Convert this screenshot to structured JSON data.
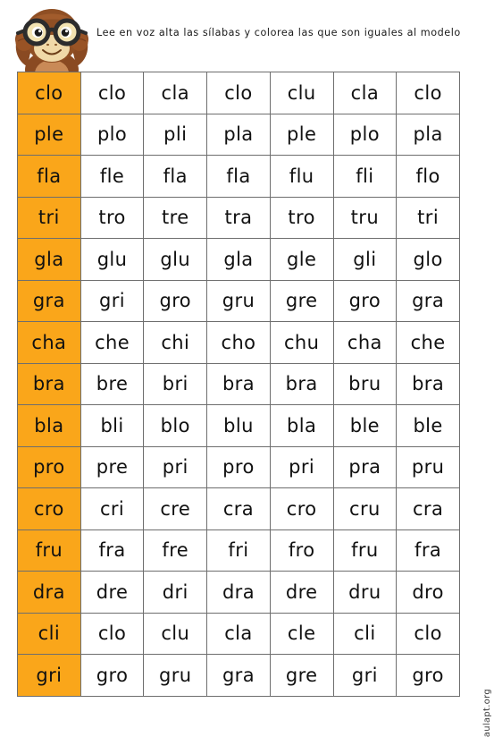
{
  "header": {
    "instruction": "Lee en voz alta las sílabas y colorea las que son iguales al modelo",
    "mascot_name": "monkey-with-glasses"
  },
  "colors": {
    "model_cell": "#faa61a",
    "grid_border": "#6e6e6e",
    "text": "#111111",
    "page_background": "#ffffff"
  },
  "table": {
    "columns": 7,
    "rows_count": 15,
    "model_column_index": 0,
    "rows": [
      {
        "model": "clo",
        "options": [
          "clo",
          "cla",
          "clo",
          "clu",
          "cla",
          "clo"
        ]
      },
      {
        "model": "ple",
        "options": [
          "plo",
          "pli",
          "pla",
          "ple",
          "plo",
          "pla"
        ]
      },
      {
        "model": "fla",
        "options": [
          "fle",
          "fla",
          "fla",
          "flu",
          "fli",
          "flo"
        ]
      },
      {
        "model": "tri",
        "options": [
          "tro",
          "tre",
          "tra",
          "tro",
          "tru",
          "tri"
        ]
      },
      {
        "model": "gla",
        "options": [
          "glu",
          "glu",
          "gla",
          "gle",
          "gli",
          "glo"
        ]
      },
      {
        "model": "gra",
        "options": [
          "gri",
          "gro",
          "gru",
          "gre",
          "gro",
          "gra"
        ]
      },
      {
        "model": "cha",
        "options": [
          "che",
          "chi",
          "cho",
          "chu",
          "cha",
          "che"
        ]
      },
      {
        "model": "bra",
        "options": [
          "bre",
          "bri",
          "bra",
          "bra",
          "bru",
          "bra"
        ]
      },
      {
        "model": "bla",
        "options": [
          "bli",
          "blo",
          "blu",
          "bla",
          "ble",
          "ble"
        ]
      },
      {
        "model": "pro",
        "options": [
          "pre",
          "pri",
          "pro",
          "pri",
          "pra",
          "pru"
        ]
      },
      {
        "model": "cro",
        "options": [
          "cri",
          "cre",
          "cra",
          "cro",
          "cru",
          "cra"
        ]
      },
      {
        "model": "fru",
        "options": [
          "fra",
          "fre",
          "fri",
          "fro",
          "fru",
          "fra"
        ]
      },
      {
        "model": "dra",
        "options": [
          "dre",
          "dri",
          "dra",
          "dre",
          "dru",
          "dro"
        ]
      },
      {
        "model": "cli",
        "options": [
          "clo",
          "clu",
          "cla",
          "cle",
          "cli",
          "clo"
        ]
      },
      {
        "model": "gri",
        "options": [
          "gro",
          "gru",
          "gra",
          "gre",
          "gri",
          "gro"
        ]
      }
    ]
  },
  "watermark": {
    "text": "aulapt.org"
  }
}
